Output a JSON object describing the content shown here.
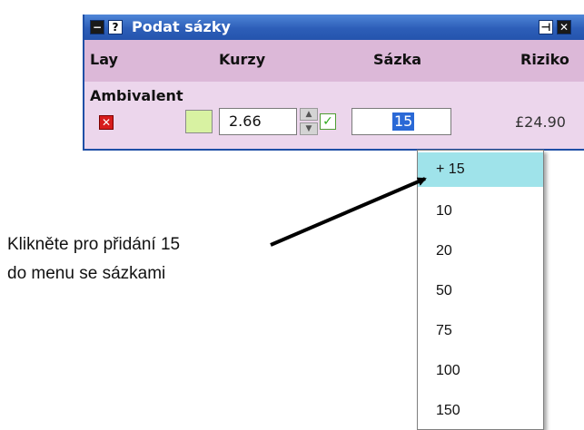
{
  "window": {
    "minimize_glyph": "−",
    "help_glyph": "?",
    "title": "Podat sázky",
    "pin_glyph": "⊣",
    "close_glyph": "✕"
  },
  "columns": {
    "lay": "Lay",
    "odds": "Kurzy",
    "stake": "Sázka",
    "risk": "Riziko"
  },
  "selection": {
    "name": "Ambivalent",
    "remove_glyph": "✕",
    "odds_value": "2.66",
    "spin_up": "▲",
    "spin_down": "▼",
    "check_glyph": "✓",
    "stake_value": "15",
    "risk_value": "£24.90"
  },
  "dropdown": {
    "items": [
      "+ 15",
      "10",
      "20",
      "50",
      "75",
      "100",
      "150"
    ],
    "highlighted_index": 0
  },
  "annotation": {
    "line1": "Klikněte pro přidání 15",
    "line2": "do menu se sázkami"
  },
  "colors": {
    "title_bar": "#2d5eb8",
    "panel": "#ecd6ec",
    "header_row": "#dcb8d8",
    "menu_highlight": "#9fe3ea",
    "selection": "#2a69d6"
  }
}
